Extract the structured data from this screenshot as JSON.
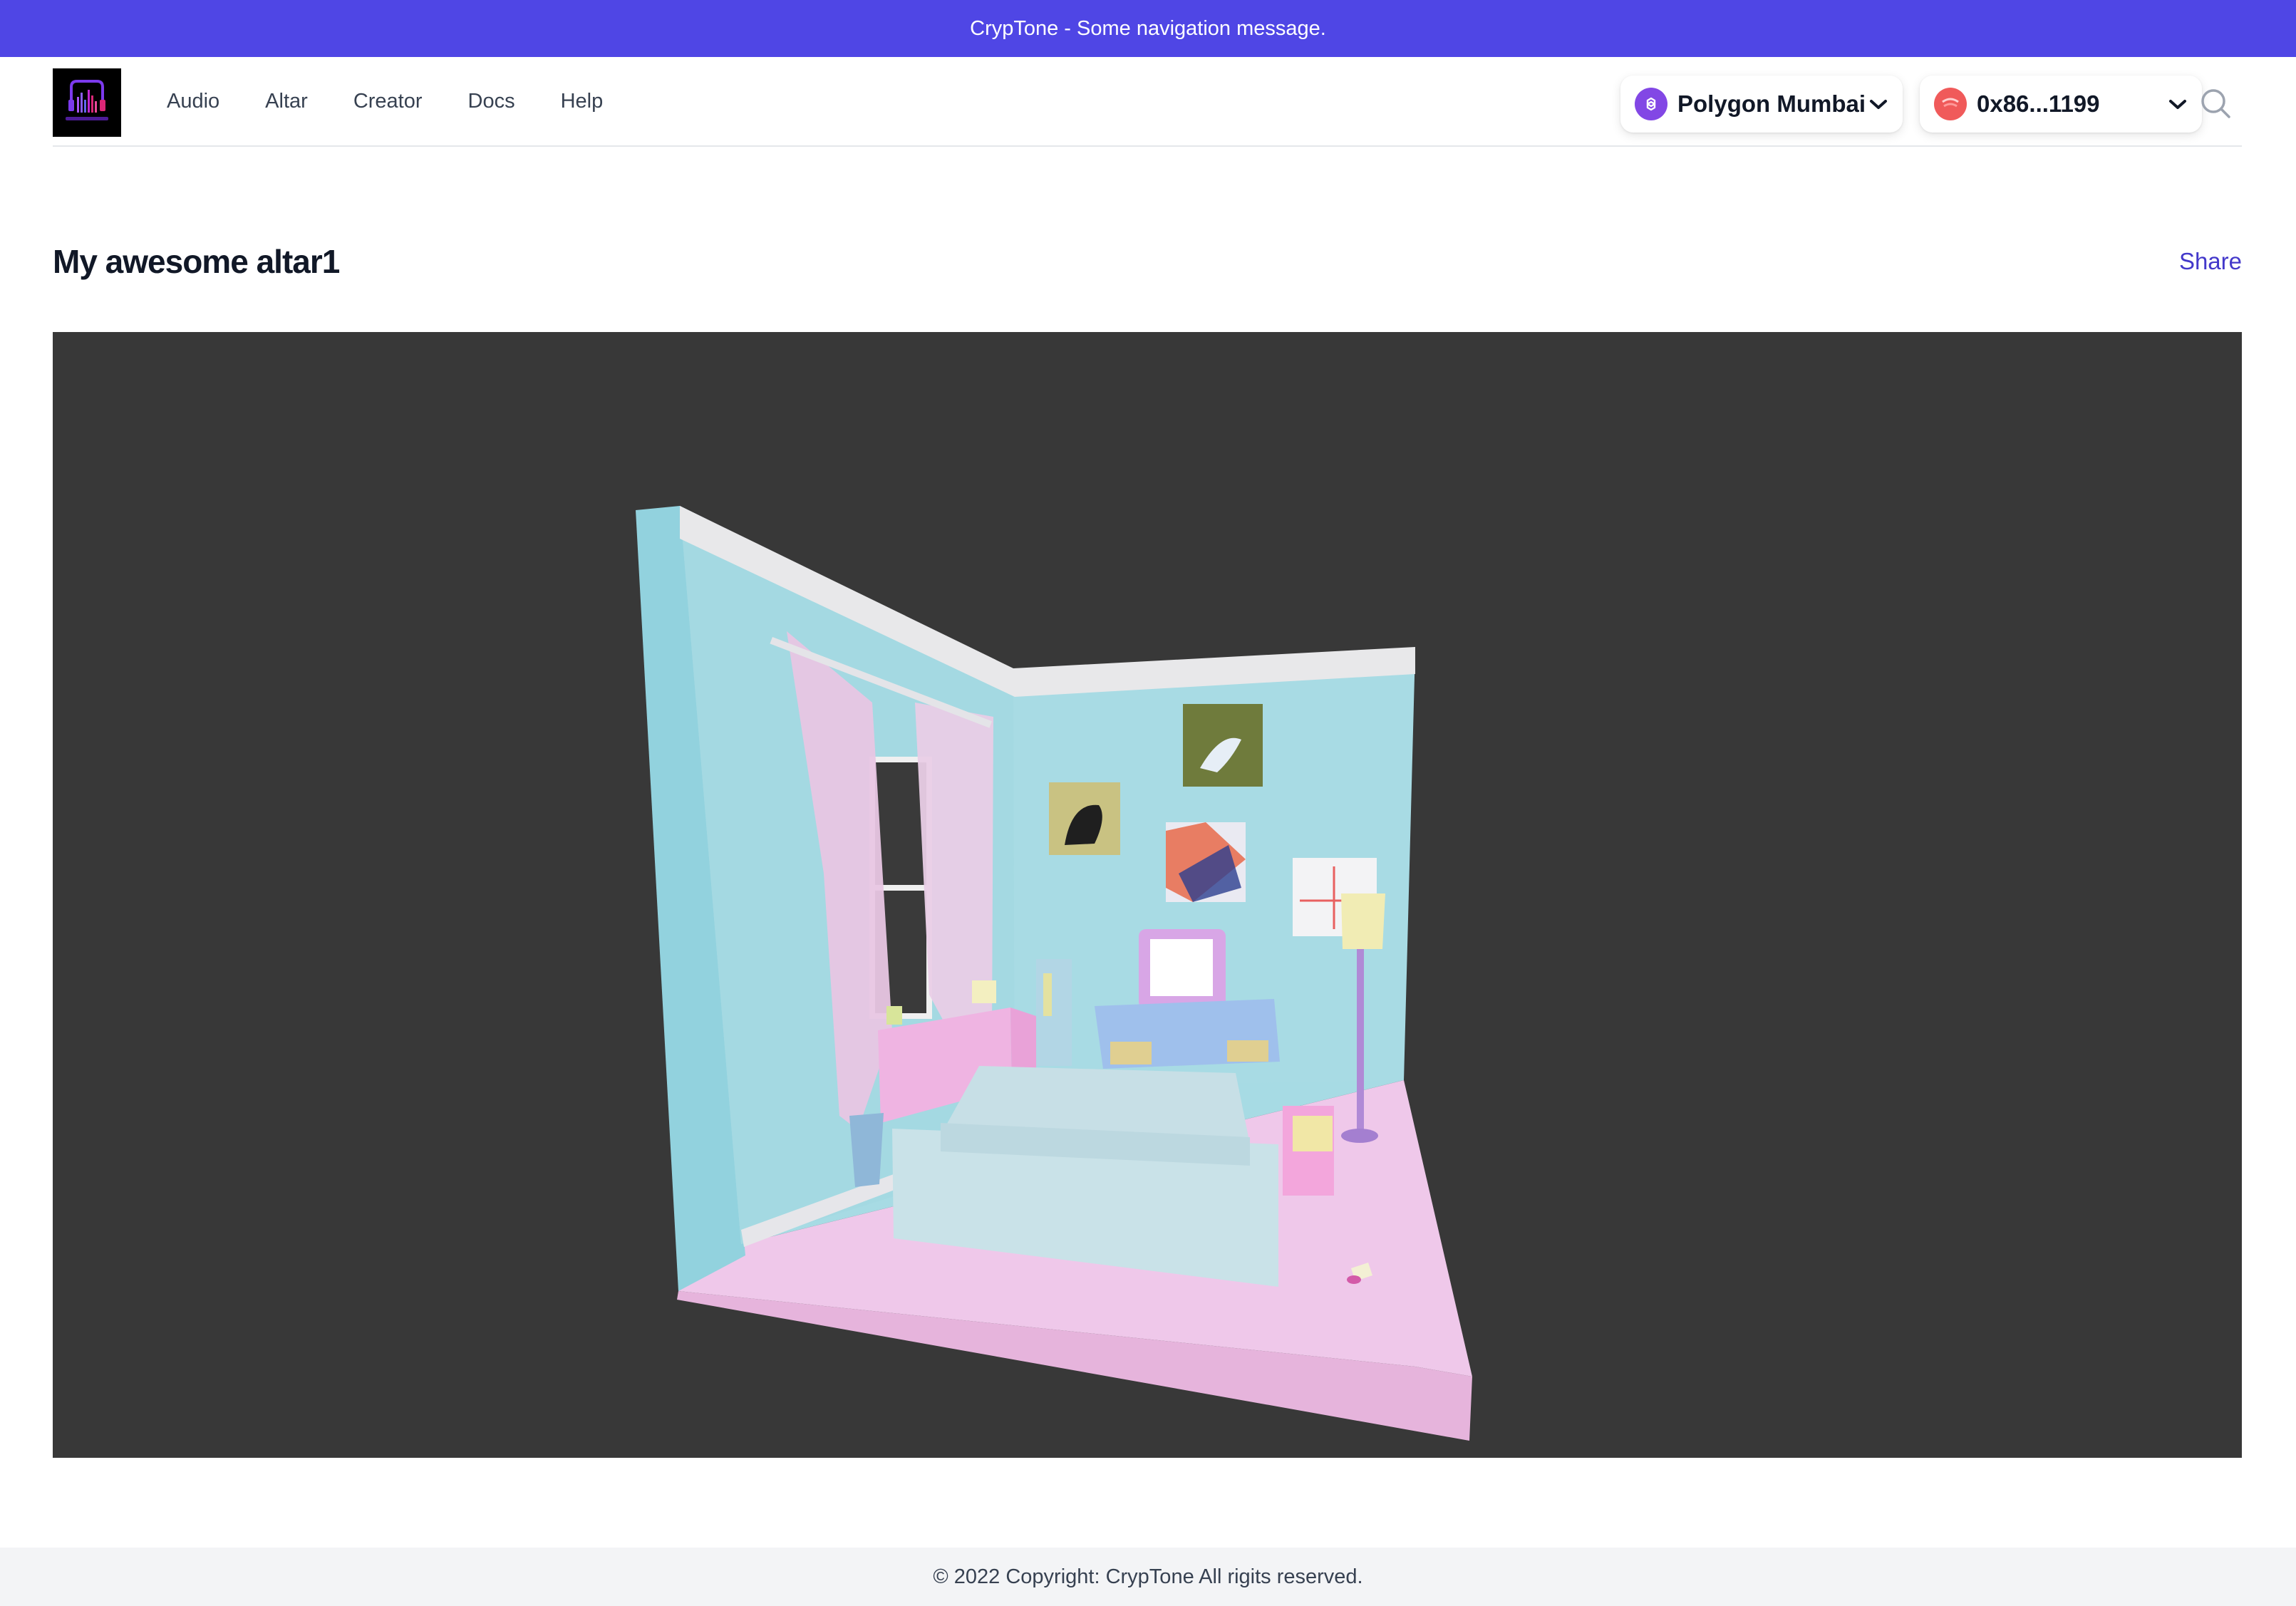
{
  "banner": {
    "message": "CrypTone - Some navigation message."
  },
  "nav": {
    "links": [
      {
        "label": "Audio"
      },
      {
        "label": "Altar"
      },
      {
        "label": "Creator"
      },
      {
        "label": "Docs"
      },
      {
        "label": "Help"
      }
    ],
    "network": {
      "label": "Polygon Mumbai",
      "icon": "polygon-icon",
      "color": "#8247e5"
    },
    "account": {
      "label": "0x86...1199",
      "icon": "account-avatar-icon",
      "color": "#f05a5a"
    },
    "search": {
      "icon": "search-icon"
    }
  },
  "page": {
    "title": "My awesome altar1",
    "share_label": "Share"
  },
  "viewer": {
    "background": "#383838",
    "scene": "3d-room-altar"
  },
  "footer": {
    "text": "© 2022 Copyright: CrypTone All rigits reserved."
  },
  "colors": {
    "accent": "#4f46e5",
    "link": "#4338ca"
  }
}
